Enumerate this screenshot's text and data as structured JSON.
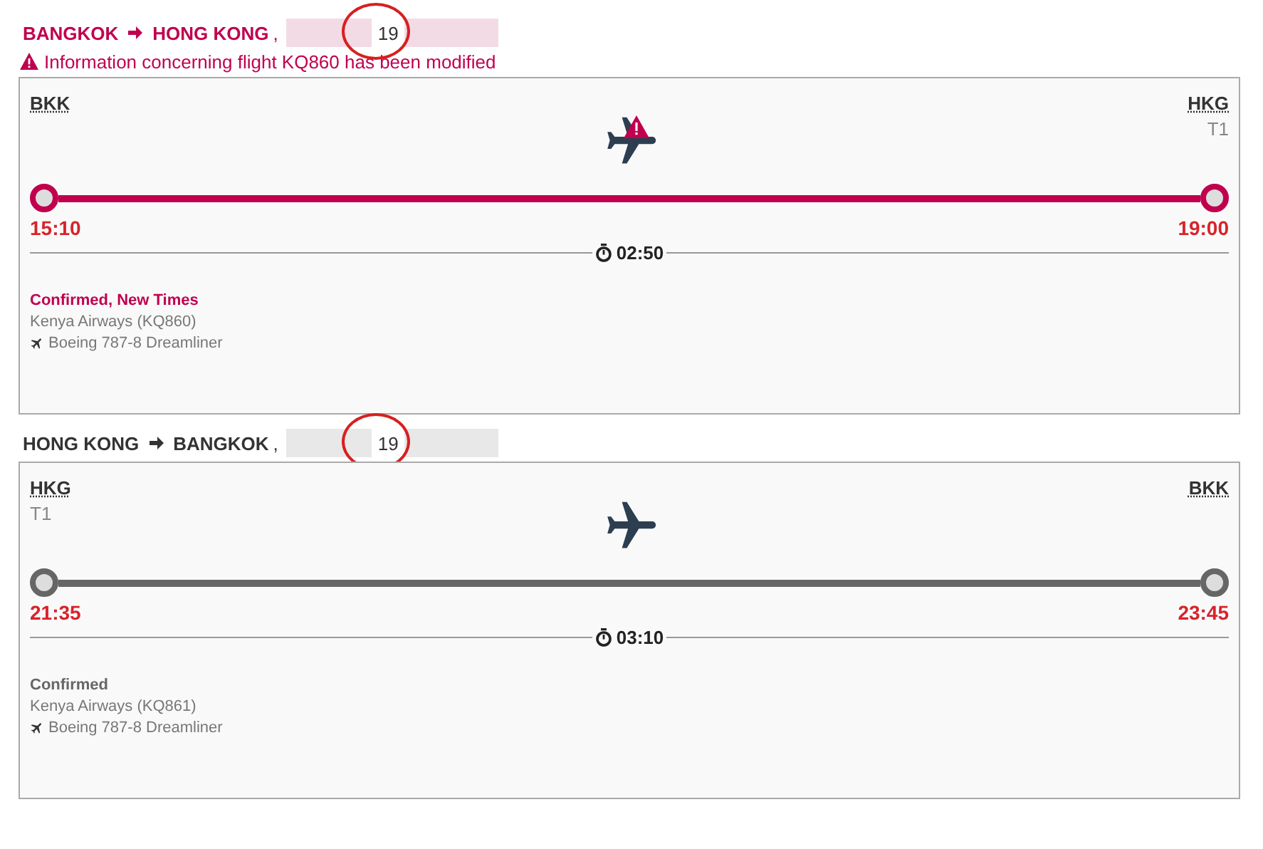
{
  "segments": [
    {
      "origin": "BANGKOK",
      "destination": "HONG KONG",
      "separator": ",",
      "date": "19",
      "modified": true,
      "notice": "Information concerning flight KQ860 has been modified",
      "from": {
        "code": "BKK"
      },
      "to": {
        "code": "HKG",
        "terminal": "T1"
      },
      "departure": "15:10",
      "arrival": "19:00",
      "duration": "02:50",
      "status": "Confirmed, New Times",
      "airline": "Kenya Airways (KQ860)",
      "aircraft": "Boeing 787-8 Dreamliner"
    },
    {
      "origin": "HONG KONG",
      "destination": "BANGKOK",
      "separator": ",",
      "date": "19",
      "modified": false,
      "from": {
        "code": "HKG",
        "terminal": "T1"
      },
      "to": {
        "code": "BKK"
      },
      "departure": "21:35",
      "arrival": "23:45",
      "duration": "03:10",
      "status": "Confirmed",
      "airline": "Kenya Airways (KQ861)",
      "aircraft": "Boeing 787-8 Dreamliner"
    }
  ]
}
